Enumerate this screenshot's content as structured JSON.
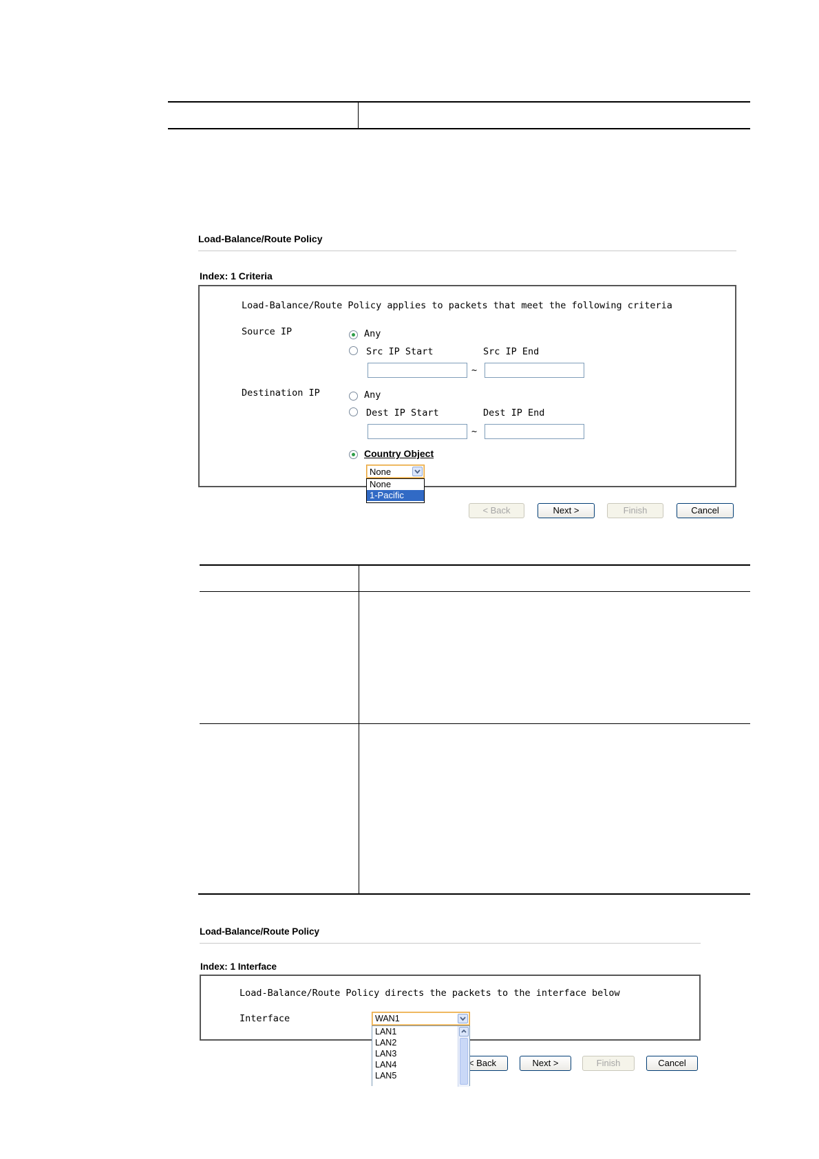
{
  "panel1": {
    "title": "Load-Balance/Route Policy",
    "section": "Index: 1 Criteria",
    "description": "Load-Balance/Route Policy applies to packets that meet the following criteria",
    "source_ip": {
      "label": "Source IP",
      "any_label": "Any",
      "range_label": "Src IP Start",
      "end_label": "Src IP End",
      "start_value": "",
      "end_value": "",
      "separator": "~",
      "selected": "Any"
    },
    "destination_ip": {
      "label": "Destination IP",
      "any_label": "Any",
      "range_label": "Dest IP Start",
      "end_label": "Dest IP End",
      "start_value": "",
      "end_value": "",
      "separator": "~",
      "country_label": "Country Object",
      "selected": "Country Object"
    },
    "country_select": {
      "value": "None",
      "options": [
        "None",
        "1-Pacific"
      ],
      "highlighted": "1-Pacific"
    },
    "buttons": {
      "back": "< Back",
      "next": "Next >",
      "finish": "Finish",
      "cancel": "Cancel"
    }
  },
  "panel2": {
    "title": "Load-Balance/Route Policy",
    "section": "Index: 1 Interface",
    "description": "Load-Balance/Route Policy directs the packets to the interface below",
    "interface_label": "Interface",
    "interface_select": {
      "value": "WAN1",
      "options": [
        "LAN1",
        "LAN2",
        "LAN3",
        "LAN4",
        "LAN5"
      ]
    },
    "buttons": {
      "back": "< Back",
      "next": "Next >",
      "finish": "Finish",
      "cancel": "Cancel"
    }
  },
  "colors": {
    "radio_selected": "#2e9e48",
    "highlight": "#316ac5",
    "select_border": "#e8a33a",
    "button_border": "#003c74"
  }
}
